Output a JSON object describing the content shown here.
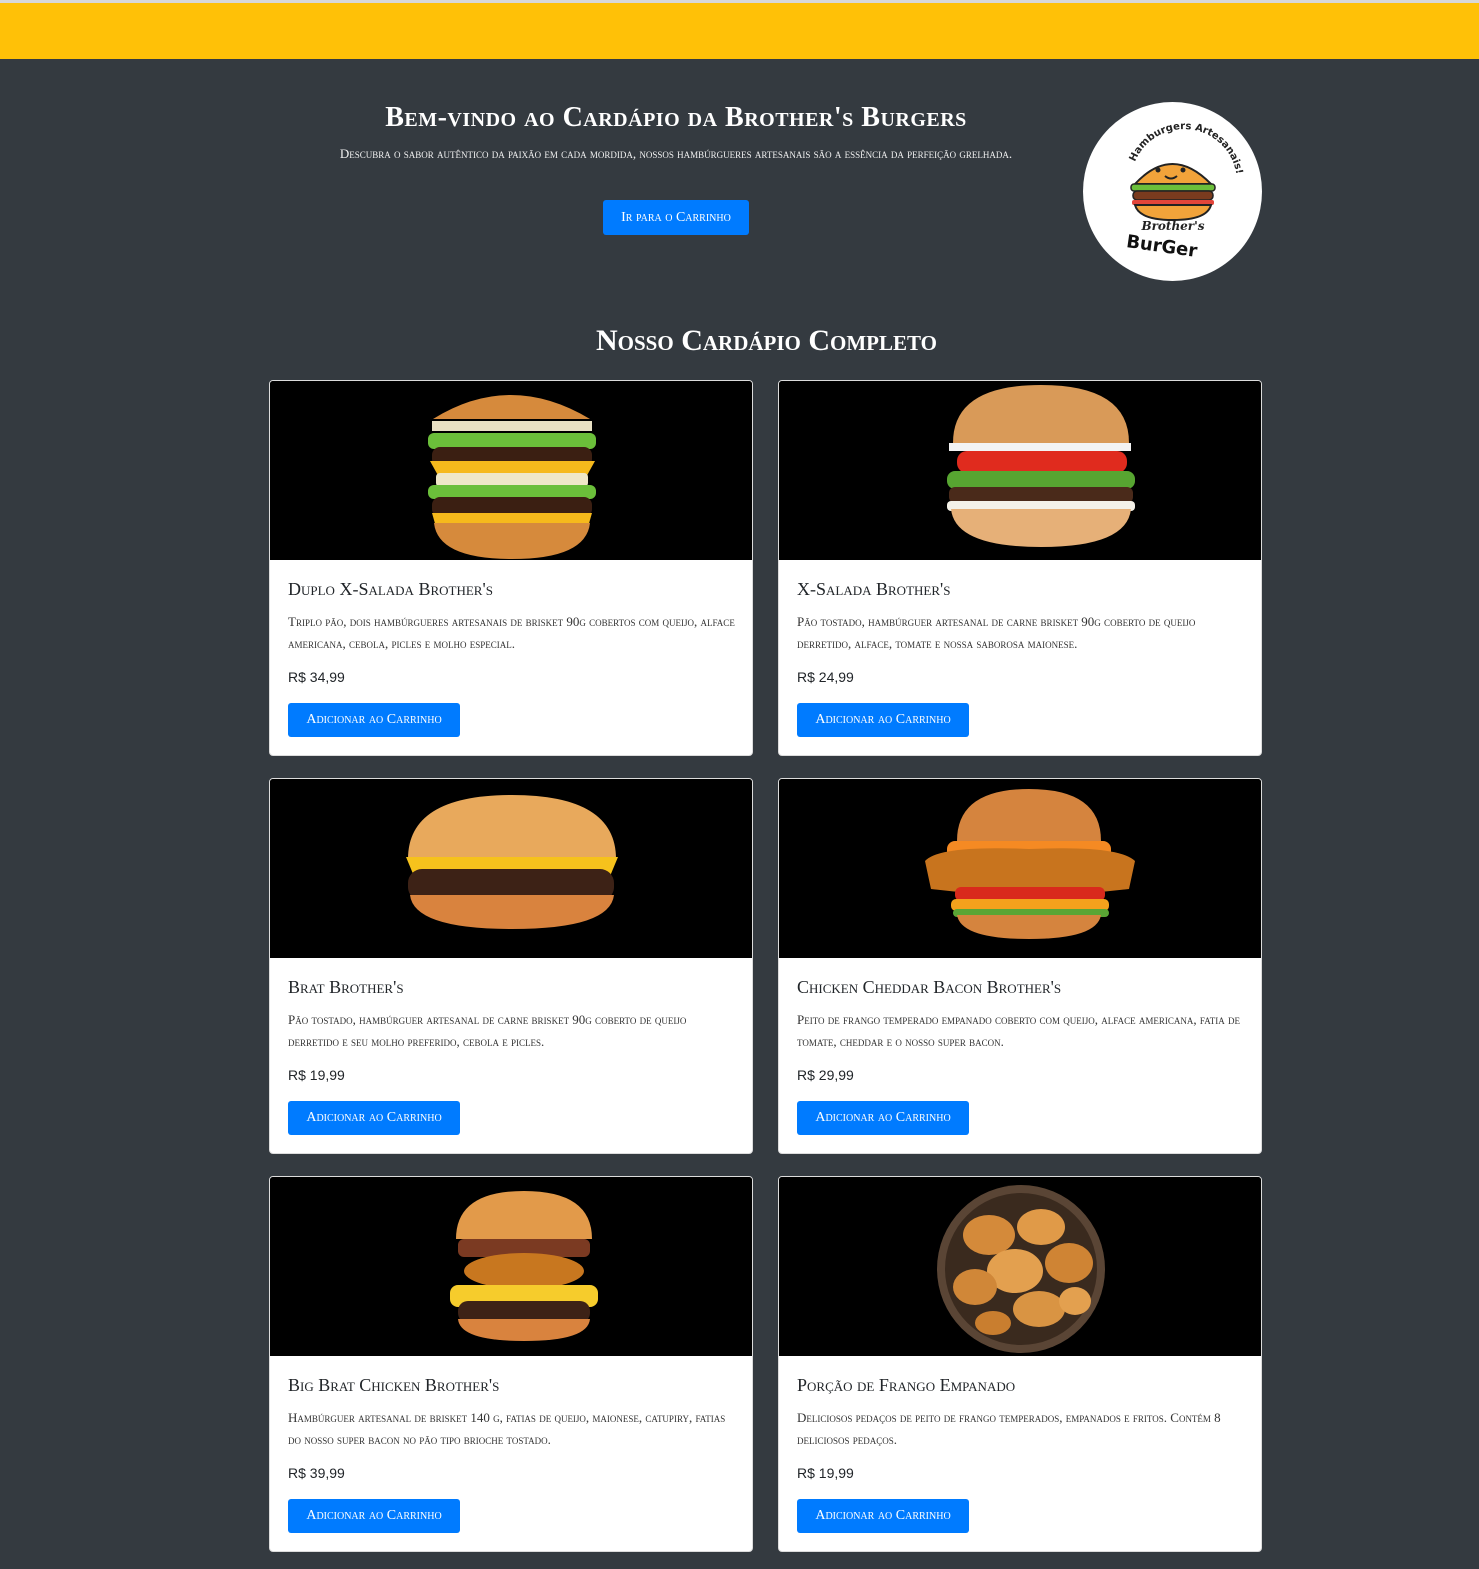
{
  "header": {
    "title": "Bem-vindo ao Cardápio da Brother's Burgers",
    "subtitle": "Descubra o sabor autêntico da paixão em cada mordida, nossos hambúrgueres artesanais são a essência da perfeição grelhada.",
    "cart_button": "Ir para o Carrinho",
    "logo": {
      "arc_text": "Hamburgers Artesanais!",
      "brand_line1": "Brother's",
      "brand_line2": "BurGer"
    }
  },
  "menu": {
    "title": "Nosso Cardápio Completo",
    "add_label": "Adicionar ao Carrinho",
    "items": [
      {
        "name": "Duplo X-Salada Brother's",
        "description": "Triplo pão, dois hambúrgueres artesanais de brisket 90g cobertos com queijo, alface americana, cebola, picles e molho especial.",
        "price": "R$ 34,99",
        "image_icon": "double-burger-image"
      },
      {
        "name": "X-Salada Brother's",
        "description": "Pão tostado, hambúrguer artesanal de carne brisket 90g coberto de queijo derretido, alface, tomate e nossa saborosa maionese.",
        "price": "R$ 24,99",
        "image_icon": "salad-burger-image"
      },
      {
        "name": "Brat Brother's",
        "description": "Pão tostado, hambúrguer artesanal de carne brisket 90g coberto de queijo derretido e seu molho preferido, cebola e picles.",
        "price": "R$ 19,99",
        "image_icon": "cheeseburger-image"
      },
      {
        "name": "Chicken Cheddar Bacon Brother's",
        "description": "Peito de frango temperado empanado coberto com queijo, alface americana, fatia de tomate, cheddar e o nosso super bacon.",
        "price": "R$ 29,99",
        "image_icon": "chicken-burger-image"
      },
      {
        "name": "Big Brat Chicken Brother's",
        "description": "Hambúrguer artesanal de brisket 140 g, fatias de queijo, maionese, catupiry, fatias do nosso super bacon no pão tipo brioche tostado.",
        "price": "R$ 39,99",
        "image_icon": "big-chicken-burger-image"
      },
      {
        "name": "Porção de Frango Empanado",
        "description": "Deliciosos pedaços de peito de frango temperados, empanados e fritos. Contém 8 deliciosos pedaços.",
        "price": "R$ 19,99",
        "image_icon": "fried-chicken-bowl-image"
      }
    ]
  },
  "colors": {
    "topbar": "#ffc107",
    "background": "#343a40",
    "primary": "#007bff"
  }
}
